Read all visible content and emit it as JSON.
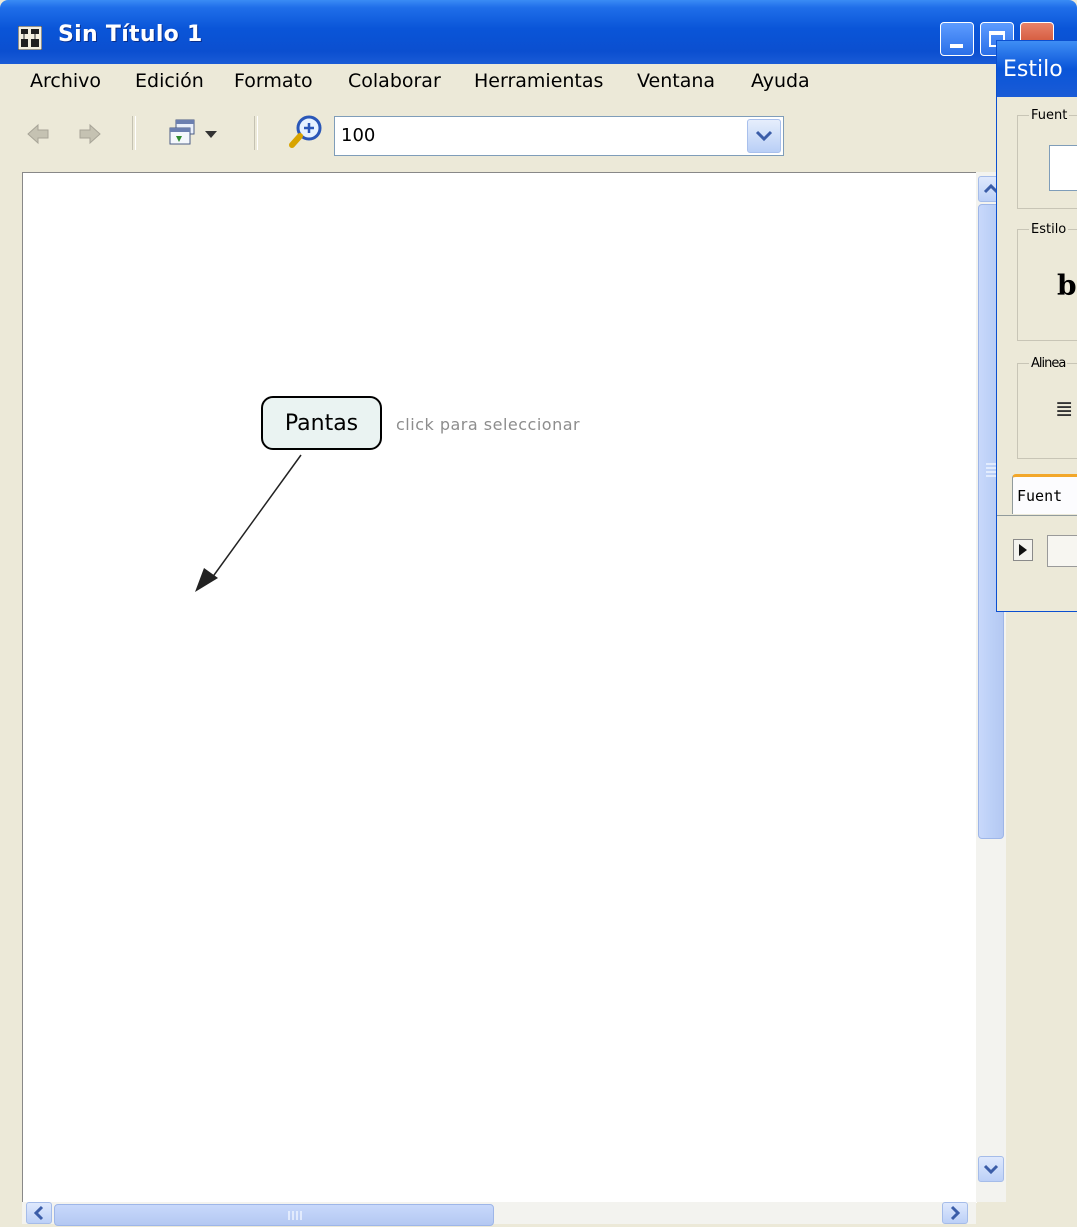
{
  "window": {
    "title": "Sin Título 1"
  },
  "menu": [
    "Archivo",
    "Edición",
    "Formato",
    "Colaborar",
    "Herramientas",
    "Ventana",
    "Ayuda"
  ],
  "toolbar": {
    "zoom_value": "100"
  },
  "canvas": {
    "concept_label": "Pantas",
    "hint_text": "click para seleccionar"
  },
  "styles_panel": {
    "title": "Estilo",
    "font_group_label": "Fuent",
    "style_group_label": "Estilo",
    "style_preview": "b",
    "align_group_label": "Alinea",
    "align_glyph": "≣",
    "tab_label": "Fuent"
  },
  "colors": {
    "title_blue": "#0a55d8",
    "window_face": "#ece9d8",
    "concept_fill": "#eaf3f2",
    "hint_gray": "#8d8d8d"
  }
}
